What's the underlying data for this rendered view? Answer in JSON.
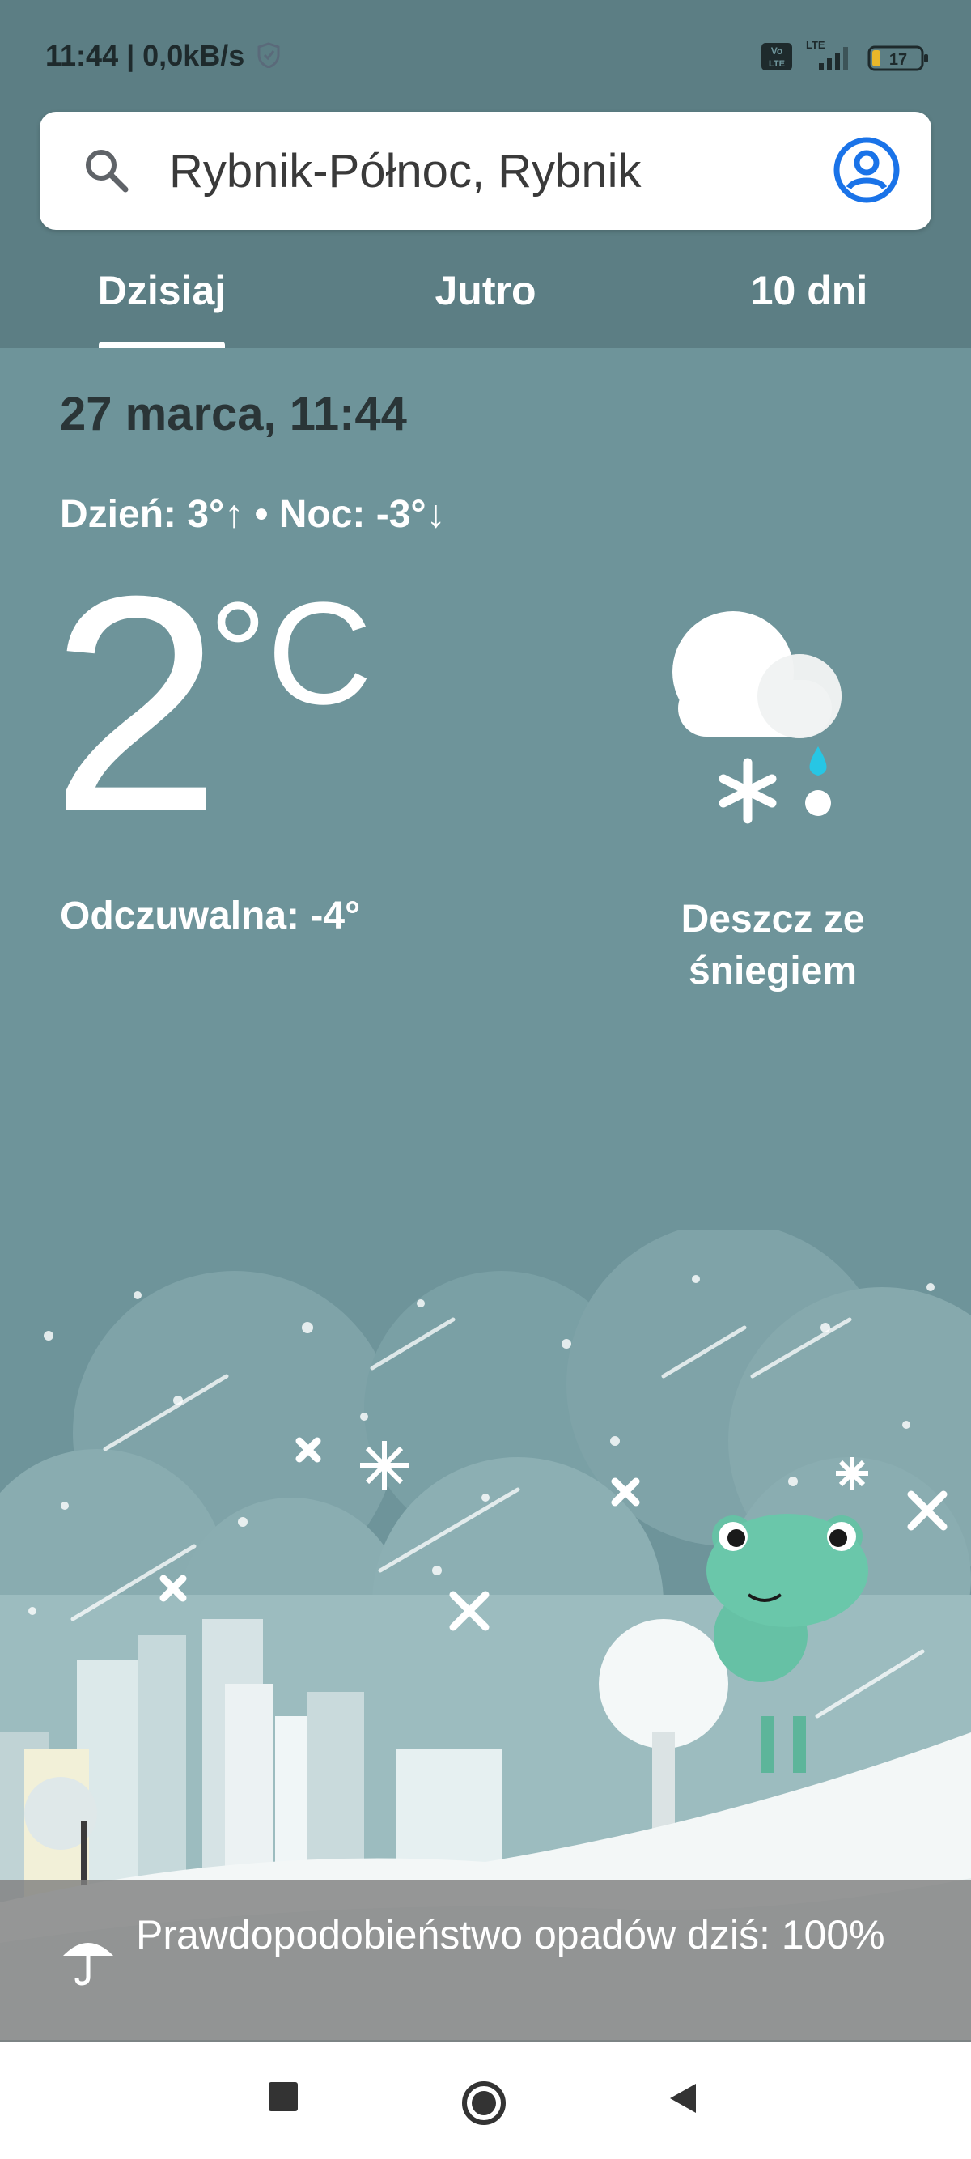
{
  "status_bar": {
    "time_speed": "11:44 | 0,0kB/s",
    "network": "LTE",
    "volte": "Vo LTE",
    "battery": "17"
  },
  "search": {
    "location": "Rybnik-Północ, Rybnik"
  },
  "tabs": [
    {
      "label": "Dzisiaj",
      "active": true
    },
    {
      "label": "Jutro",
      "active": false
    },
    {
      "label": "10 dni",
      "active": false
    }
  ],
  "weather": {
    "date_time": "27 marca, 11:44",
    "day_night": "Dzień: 3°↑ • Noc: -3°↓",
    "temperature": "2",
    "unit": "°C",
    "feels_like": "Odczuwalna: -4°",
    "condition": "Deszcz ze śniegiem",
    "condition_icon": "sleet-icon"
  },
  "precipitation": {
    "text": "Prawdopodobieństwo opadów dziś: 100%"
  },
  "colors": {
    "header_bg": "#5c7e84",
    "sky": "#6e949a",
    "accent_blue": "#1a73e8"
  }
}
